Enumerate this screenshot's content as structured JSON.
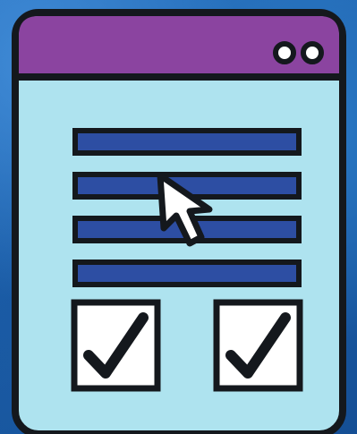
{
  "illustration": {
    "name": "web-form-checklist-icon",
    "colors": {
      "background": "#1f64ad",
      "window": "#aee3ef",
      "title_bar": "#8b44a0",
      "outline": "#14181d",
      "text_lines": "#2d4ea3",
      "checkbox_fill": "#ffffff",
      "cursor_fill": "#ffffff",
      "window_buttons": "#ffffff"
    },
    "form_lines": 4,
    "checkboxes": [
      {
        "checked": true
      },
      {
        "checked": true
      }
    ],
    "icons": [
      "window-icon",
      "cursor-icon",
      "checkmark-icon"
    ]
  }
}
